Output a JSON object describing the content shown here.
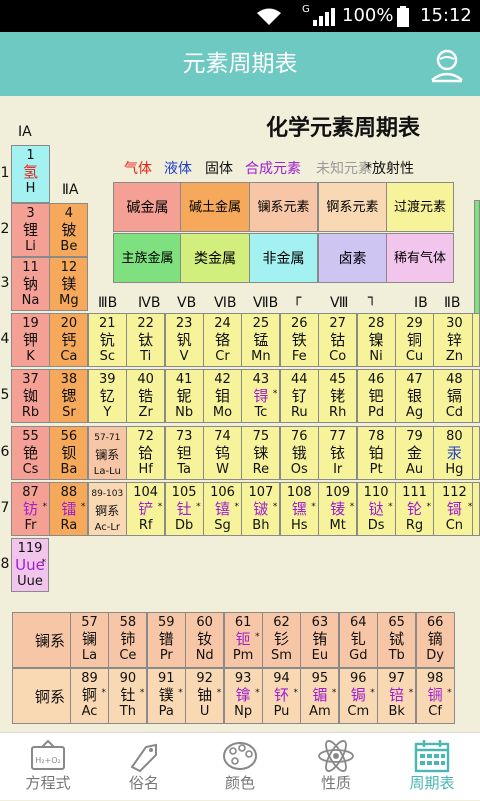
{
  "status_bar": {
    "signal_label": "G",
    "battery_percent": "100%",
    "time": "15:12"
  },
  "header": {
    "title": "元素周期表"
  },
  "table": {
    "title": "化学元素周期表",
    "legend_states": [
      {
        "label": "气体",
        "color": "#e8221b"
      },
      {
        "label": "液体",
        "color": "#1d3fc9"
      },
      {
        "label": "固体",
        "color": "#111111"
      },
      {
        "label": "合成元素",
        "color": "#a020d0"
      },
      {
        "label": "未知元素",
        "color": "#9a9a9a"
      },
      {
        "label": "*放射性",
        "color": "#111111"
      }
    ],
    "legend_categories": [
      {
        "label": "碱金属",
        "color": "#f5a094"
      },
      {
        "label": "碱土金属",
        "color": "#f6a95a"
      },
      {
        "label": "镧系元素",
        "color": "#f7c6a6"
      },
      {
        "label": "锕系元素",
        "color": "#f9d9b3"
      },
      {
        "label": "过渡元素",
        "color": "#f7f39a"
      },
      {
        "label": "主族金属",
        "color": "#7ee07e"
      },
      {
        "label": "类金属",
        "color": "#d2ee7c"
      },
      {
        "label": "非金属",
        "color": "#a4f1f1"
      },
      {
        "label": "卤素",
        "color": "#cfc5f3"
      },
      {
        "label": "稀有气体",
        "color": "#f2c6ec"
      }
    ],
    "group_labels": {
      "g1": "ⅠA",
      "g2": "ⅡA",
      "g3": "ⅢB",
      "g4": "ⅣB",
      "g5": "ⅤB",
      "g6": "ⅥB",
      "g7": "ⅦB",
      "g8": "Ⅷ",
      "g8l": "┌",
      "g8r": "┐",
      "g11": "ⅠB",
      "g12": "ⅡB"
    },
    "period_labels": [
      "1",
      "2",
      "3",
      "4",
      "5",
      "6",
      "7",
      "8"
    ],
    "elements": [
      {
        "num": "1",
        "cn": "氢",
        "sym": "H",
        "cat": "nonmetal",
        "state": "gas",
        "row": 1,
        "col": 1
      },
      {
        "num": "3",
        "cn": "锂",
        "sym": "Li",
        "cat": "alkali",
        "state": "solid",
        "row": 2,
        "col": 1
      },
      {
        "num": "4",
        "cn": "铍",
        "sym": "Be",
        "cat": "alkaline",
        "state": "solid",
        "row": 2,
        "col": 2
      },
      {
        "num": "11",
        "cn": "钠",
        "sym": "Na",
        "cat": "alkali",
        "state": "solid",
        "row": 3,
        "col": 1
      },
      {
        "num": "12",
        "cn": "镁",
        "sym": "Mg",
        "cat": "alkaline",
        "state": "solid",
        "row": 3,
        "col": 2
      },
      {
        "num": "19",
        "cn": "钾",
        "sym": "K",
        "cat": "alkali",
        "state": "solid",
        "row": 4,
        "col": 1
      },
      {
        "num": "20",
        "cn": "钙",
        "sym": "Ca",
        "cat": "alkaline",
        "state": "solid",
        "row": 4,
        "col": 2
      },
      {
        "num": "21",
        "cn": "钪",
        "sym": "Sc",
        "cat": "transition",
        "state": "solid",
        "row": 4,
        "col": 3
      },
      {
        "num": "22",
        "cn": "钛",
        "sym": "Ti",
        "cat": "transition",
        "state": "solid",
        "row": 4,
        "col": 4
      },
      {
        "num": "23",
        "cn": "钒",
        "sym": "V",
        "cat": "transition",
        "state": "solid",
        "row": 4,
        "col": 5
      },
      {
        "num": "24",
        "cn": "铬",
        "sym": "Cr",
        "cat": "transition",
        "state": "solid",
        "row": 4,
        "col": 6
      },
      {
        "num": "25",
        "cn": "锰",
        "sym": "Mn",
        "cat": "transition",
        "state": "solid",
        "row": 4,
        "col": 7
      },
      {
        "num": "26",
        "cn": "铁",
        "sym": "Fe",
        "cat": "transition",
        "state": "solid",
        "row": 4,
        "col": 8
      },
      {
        "num": "27",
        "cn": "钴",
        "sym": "Co",
        "cat": "transition",
        "state": "solid",
        "row": 4,
        "col": 9
      },
      {
        "num": "28",
        "cn": "镍",
        "sym": "Ni",
        "cat": "transition",
        "state": "solid",
        "row": 4,
        "col": 10
      },
      {
        "num": "29",
        "cn": "铜",
        "sym": "Cu",
        "cat": "transition",
        "state": "solid",
        "row": 4,
        "col": 11
      },
      {
        "num": "30",
        "cn": "锌",
        "sym": "Zn",
        "cat": "transition",
        "state": "solid",
        "row": 4,
        "col": 12
      },
      {
        "num": "37",
        "cn": "铷",
        "sym": "Rb",
        "cat": "alkali",
        "state": "solid",
        "row": 5,
        "col": 1
      },
      {
        "num": "38",
        "cn": "锶",
        "sym": "Sr",
        "cat": "alkaline",
        "state": "solid",
        "row": 5,
        "col": 2
      },
      {
        "num": "39",
        "cn": "钇",
        "sym": "Y",
        "cat": "transition",
        "state": "solid",
        "row": 5,
        "col": 3
      },
      {
        "num": "40",
        "cn": "锆",
        "sym": "Zr",
        "cat": "transition",
        "state": "solid",
        "row": 5,
        "col": 4
      },
      {
        "num": "41",
        "cn": "铌",
        "sym": "Nb",
        "cat": "transition",
        "state": "solid",
        "row": 5,
        "col": 5
      },
      {
        "num": "42",
        "cn": "钼",
        "sym": "Mo",
        "cat": "transition",
        "state": "solid",
        "row": 5,
        "col": 6
      },
      {
        "num": "43",
        "cn": "锝",
        "sym": "Tc",
        "cat": "transition",
        "state": "synthetic",
        "radioactive": true,
        "row": 5,
        "col": 7
      },
      {
        "num": "44",
        "cn": "钌",
        "sym": "Ru",
        "cat": "transition",
        "state": "solid",
        "row": 5,
        "col": 8
      },
      {
        "num": "45",
        "cn": "铑",
        "sym": "Rh",
        "cat": "transition",
        "state": "solid",
        "row": 5,
        "col": 9
      },
      {
        "num": "46",
        "cn": "钯",
        "sym": "Pd",
        "cat": "transition",
        "state": "solid",
        "row": 5,
        "col": 10
      },
      {
        "num": "47",
        "cn": "银",
        "sym": "Ag",
        "cat": "transition",
        "state": "solid",
        "row": 5,
        "col": 11
      },
      {
        "num": "48",
        "cn": "镉",
        "sym": "Cd",
        "cat": "transition",
        "state": "solid",
        "row": 5,
        "col": 12
      },
      {
        "num": "55",
        "cn": "铯",
        "sym": "Cs",
        "cat": "alkali",
        "state": "solid",
        "row": 6,
        "col": 1
      },
      {
        "num": "56",
        "cn": "钡",
        "sym": "Ba",
        "cat": "alkaline",
        "state": "solid",
        "row": 6,
        "col": 2
      },
      {
        "num": "57-71",
        "cn": "镧系",
        "sym": "La-Lu",
        "cat": "lanthanide",
        "state": "solid",
        "small": true,
        "row": 6,
        "col": 3
      },
      {
        "num": "72",
        "cn": "铪",
        "sym": "Hf",
        "cat": "transition",
        "state": "solid",
        "row": 6,
        "col": 4
      },
      {
        "num": "73",
        "cn": "钽",
        "sym": "Ta",
        "cat": "transition",
        "state": "solid",
        "row": 6,
        "col": 5
      },
      {
        "num": "74",
        "cn": "钨",
        "sym": "W",
        "cat": "transition",
        "state": "solid",
        "row": 6,
        "col": 6
      },
      {
        "num": "75",
        "cn": "铼",
        "sym": "Re",
        "cat": "transition",
        "state": "solid",
        "row": 6,
        "col": 7
      },
      {
        "num": "76",
        "cn": "锇",
        "sym": "Os",
        "cat": "transition",
        "state": "solid",
        "row": 6,
        "col": 8
      },
      {
        "num": "77",
        "cn": "铱",
        "sym": "Ir",
        "cat": "transition",
        "state": "solid",
        "row": 6,
        "col": 9
      },
      {
        "num": "78",
        "cn": "铂",
        "sym": "Pt",
        "cat": "transition",
        "state": "solid",
        "row": 6,
        "col": 10
      },
      {
        "num": "79",
        "cn": "金",
        "sym": "Au",
        "cat": "transition",
        "state": "solid",
        "row": 6,
        "col": 11
      },
      {
        "num": "80",
        "cn": "汞",
        "sym": "Hg",
        "cat": "transition",
        "state": "liquid",
        "row": 6,
        "col": 12
      },
      {
        "num": "87",
        "cn": "钫",
        "sym": "Fr",
        "cat": "alkali",
        "state": "synthetic",
        "radioactive": true,
        "row": 7,
        "col": 1
      },
      {
        "num": "88",
        "cn": "镭",
        "sym": "Ra",
        "cat": "alkaline",
        "state": "synthetic",
        "radioactive": true,
        "row": 7,
        "col": 2
      },
      {
        "num": "89-103",
        "cn": "锕系",
        "sym": "Ac-Lr",
        "cat": "actinide",
        "state": "solid",
        "small": true,
        "row": 7,
        "col": 3
      },
      {
        "num": "104",
        "cn": "铲",
        "sym": "Rf",
        "cat": "transition",
        "state": "synthetic",
        "radioactive": true,
        "row": 7,
        "col": 4
      },
      {
        "num": "105",
        "cn": "钍",
        "sym": "Db",
        "cat": "transition",
        "state": "synthetic",
        "radioactive": true,
        "row": 7,
        "col": 5
      },
      {
        "num": "106",
        "cn": "𬭳",
        "sym": "Sg",
        "cat": "transition",
        "state": "synthetic",
        "radioactive": true,
        "row": 7,
        "col": 6
      },
      {
        "num": "107",
        "cn": "𬭛",
        "sym": "Bh",
        "cat": "transition",
        "state": "synthetic",
        "radioactive": true,
        "row": 7,
        "col": 7
      },
      {
        "num": "108",
        "cn": "𬭶",
        "sym": "Hs",
        "cat": "transition",
        "state": "synthetic",
        "radioactive": true,
        "row": 7,
        "col": 8
      },
      {
        "num": "109",
        "cn": "鿏",
        "sym": "Mt",
        "cat": "transition",
        "state": "synthetic",
        "radioactive": true,
        "row": 7,
        "col": 9
      },
      {
        "num": "110",
        "cn": "𫟼",
        "sym": "Ds",
        "cat": "transition",
        "state": "synthetic",
        "radioactive": true,
        "row": 7,
        "col": 10
      },
      {
        "num": "111",
        "cn": "𬬭",
        "sym": "Rg",
        "cat": "transition",
        "state": "synthetic",
        "radioactive": true,
        "row": 7,
        "col": 11
      },
      {
        "num": "112",
        "cn": "鿔",
        "sym": "Cn",
        "cat": "transition",
        "state": "synthetic",
        "radioactive": true,
        "row": 7,
        "col": 12
      },
      {
        "num": "119",
        "cn": "Uue",
        "sym": "Uue",
        "cat": "unknown",
        "state": "synthetic",
        "radioactive": true,
        "row": 8,
        "col": 1
      }
    ],
    "series_labels": {
      "lanthanide": "镧系",
      "actinide": "锕系"
    },
    "lanthanides": [
      {
        "num": "57",
        "cn": "镧",
        "sym": "La",
        "state": "solid"
      },
      {
        "num": "58",
        "cn": "铈",
        "sym": "Ce",
        "state": "solid"
      },
      {
        "num": "59",
        "cn": "镨",
        "sym": "Pr",
        "state": "solid"
      },
      {
        "num": "60",
        "cn": "钕",
        "sym": "Nd",
        "state": "solid"
      },
      {
        "num": "61",
        "cn": "钷",
        "sym": "Pm",
        "state": "synthetic",
        "radioactive": true
      },
      {
        "num": "62",
        "cn": "钐",
        "sym": "Sm",
        "state": "solid"
      },
      {
        "num": "63",
        "cn": "铕",
        "sym": "Eu",
        "state": "solid"
      },
      {
        "num": "64",
        "cn": "钆",
        "sym": "Gd",
        "state": "solid"
      },
      {
        "num": "65",
        "cn": "铽",
        "sym": "Tb",
        "state": "solid"
      },
      {
        "num": "66",
        "cn": "镝",
        "sym": "Dy",
        "state": "solid"
      }
    ],
    "actinides": [
      {
        "num": "89",
        "cn": "锕",
        "sym": "Ac",
        "state": "solid",
        "radioactive": true
      },
      {
        "num": "90",
        "cn": "钍",
        "sym": "Th",
        "state": "solid",
        "radioactive": true
      },
      {
        "num": "91",
        "cn": "镤",
        "sym": "Pa",
        "state": "solid",
        "radioactive": true
      },
      {
        "num": "92",
        "cn": "铀",
        "sym": "U",
        "state": "solid",
        "radioactive": true
      },
      {
        "num": "93",
        "cn": "镎",
        "sym": "Np",
        "state": "synthetic",
        "radioactive": true
      },
      {
        "num": "94",
        "cn": "钚",
        "sym": "Pu",
        "state": "synthetic",
        "radioactive": true
      },
      {
        "num": "95",
        "cn": "镅",
        "sym": "Am",
        "state": "synthetic",
        "radioactive": true
      },
      {
        "num": "96",
        "cn": "锔",
        "sym": "Cm",
        "state": "synthetic",
        "radioactive": true
      },
      {
        "num": "97",
        "cn": "锫",
        "sym": "Bk",
        "state": "synthetic",
        "radioactive": true
      },
      {
        "num": "98",
        "cn": "锎",
        "sym": "Cf",
        "state": "synthetic",
        "radioactive": true
      }
    ],
    "category_colors": {
      "alkali": "#f5a094",
      "alkaline": "#f6a95a",
      "lanthanide": "#f7c6a6",
      "actinide": "#f9d9b3",
      "transition": "#f7f39a",
      "mainmetal": "#7ee07e",
      "metalloid": "#d2ee7c",
      "nonmetal": "#a4f1f1",
      "halogen": "#cfc5f3",
      "noble": "#f2c6ec",
      "unknown": "#f2c6ec"
    },
    "state_colors": {
      "gas": "#e8221b",
      "liquid": "#1d3fc9",
      "solid": "#111111",
      "synthetic": "#a020d0"
    },
    "radioactive_mark": "*"
  },
  "tabs": [
    {
      "label": "方程式",
      "icon": "equation-icon",
      "active": false
    },
    {
      "label": "俗名",
      "icon": "tag-icon",
      "active": false
    },
    {
      "label": "颜色",
      "icon": "palette-icon",
      "active": false
    },
    {
      "label": "性质",
      "icon": "atom-icon",
      "active": false
    },
    {
      "label": "周期表",
      "icon": "calendar-grid-icon",
      "active": true
    }
  ],
  "accent_color": "#6dc9c2"
}
